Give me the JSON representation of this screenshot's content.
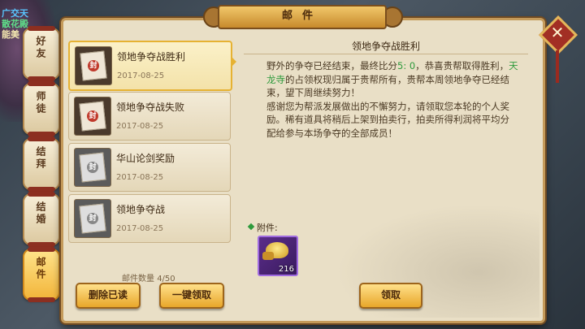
{
  "overlay_texts": [
    "广交天",
    "散花殿",
    "能美"
  ],
  "side_tabs": [
    {
      "label": "好友"
    },
    {
      "label": "师徒"
    },
    {
      "label": "结拜"
    },
    {
      "label": "结婚"
    },
    {
      "label": "邮件"
    }
  ],
  "window": {
    "title": "邮件",
    "close_label": "✕"
  },
  "mails": [
    {
      "title": "领地争夺战胜利",
      "date": "2017-08-25",
      "seal": "封"
    },
    {
      "title": "领地争夺战失败",
      "date": "2017-08-25",
      "seal": "封"
    },
    {
      "title": "华山论剑奖励",
      "date": "2017-08-25",
      "seal": "封"
    },
    {
      "title": "领地争夺战",
      "date": "2017-08-25",
      "seal": "封"
    }
  ],
  "mail_count": {
    "label": "邮件数量",
    "value": "4/50"
  },
  "buttons": {
    "delete_read": "删除已读",
    "claim_all": "一键领取",
    "claim": "领取"
  },
  "detail": {
    "title": "领地争夺战胜利",
    "p1_a": "野外的争夺已经结束，最终比分",
    "score": "5: 0",
    "p1_b": "，恭喜贵帮取得胜利，",
    "place": "天龙寺",
    "p1_c": "的占领权现归属于贵帮所有，贵帮本周领地争夺已经结束，望下周继续努力！",
    "p2": "感谢您为帮派发展做出的不懈努力，请领取您本轮的个人奖励。稀有道具将稍后上架到拍卖行，拍卖所得利润将平均分配给参与本场争夺的全部成员！",
    "attachment_label": "附件:",
    "attachment_count": "216"
  },
  "colors": {
    "accent_gold": "#e6b233",
    "highlight_green": "#2e9a3c",
    "score_color": "#2e9a3c"
  }
}
